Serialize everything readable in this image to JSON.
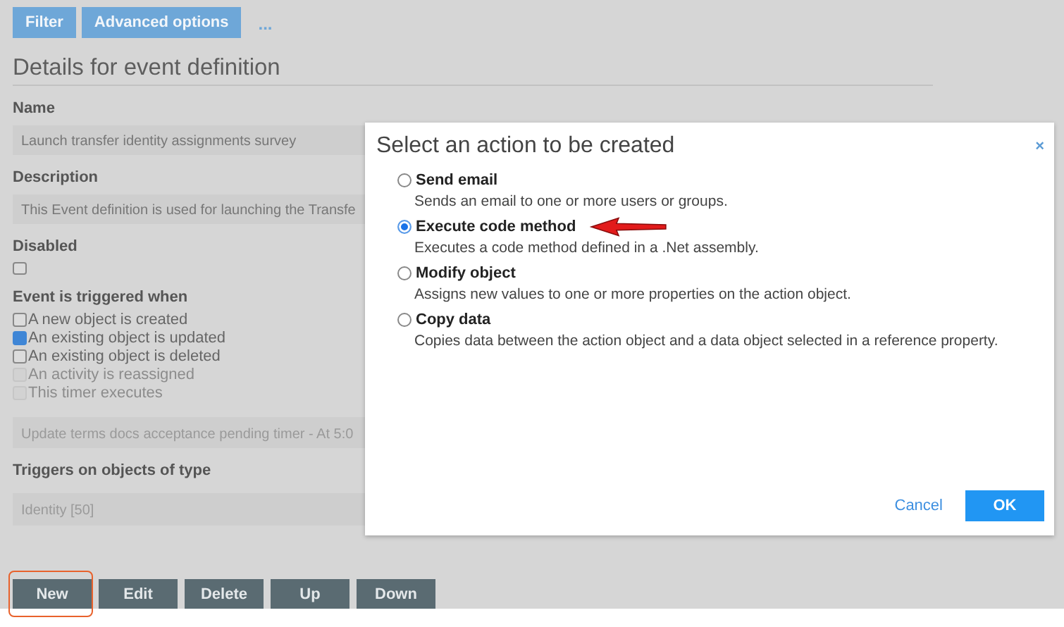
{
  "toolbar": {
    "buttons": [
      "Filter",
      "Advanced options"
    ],
    "more": "..."
  },
  "details": {
    "title": "Details for event definition",
    "name": {
      "label": "Name",
      "value": "Launch transfer identity assignments survey"
    },
    "description": {
      "label": "Description",
      "value": "This Event definition is used for launching the Transfe"
    },
    "disabled": {
      "label": "Disabled",
      "checked": false
    },
    "triggers": {
      "label": "Event is triggered when",
      "options": [
        {
          "label": "A new object is created",
          "checked": false,
          "disabled": false
        },
        {
          "label": "An existing object is updated",
          "checked": true,
          "disabled": false
        },
        {
          "label": "An existing object is deleted",
          "checked": false,
          "disabled": false
        },
        {
          "label": "An activity is reassigned",
          "checked": false,
          "disabled": true
        },
        {
          "label": "This timer executes",
          "checked": false,
          "disabled": true
        }
      ]
    },
    "timer": {
      "value": "Update terms docs acceptance pending timer - At 5:0"
    },
    "object_type": {
      "label": "Triggers on objects of type",
      "value": "Identity [50]"
    }
  },
  "actions": [
    {
      "label": "New",
      "highlighted": true
    },
    {
      "label": "Edit",
      "highlighted": false
    },
    {
      "label": "Delete",
      "highlighted": false
    },
    {
      "label": "Up",
      "highlighted": false
    },
    {
      "label": "Down",
      "highlighted": false
    }
  ],
  "dialog": {
    "title": "Select an action to be created",
    "close": "×",
    "options": [
      {
        "title": "Send email",
        "description": "Sends an email to one or more users or groups.",
        "selected": false,
        "pointed": false
      },
      {
        "title": "Execute code method",
        "description": "Executes a code method defined in a .Net assembly.",
        "selected": true,
        "pointed": true
      },
      {
        "title": "Modify object",
        "description": "Assigns new values to one or more properties on the action object.",
        "selected": false,
        "pointed": false
      },
      {
        "title": "Copy data",
        "description": "Copies data between the action object and a data object selected in a reference property.",
        "selected": false,
        "pointed": false
      }
    ],
    "cancel": "Cancel",
    "ok": "OK"
  }
}
